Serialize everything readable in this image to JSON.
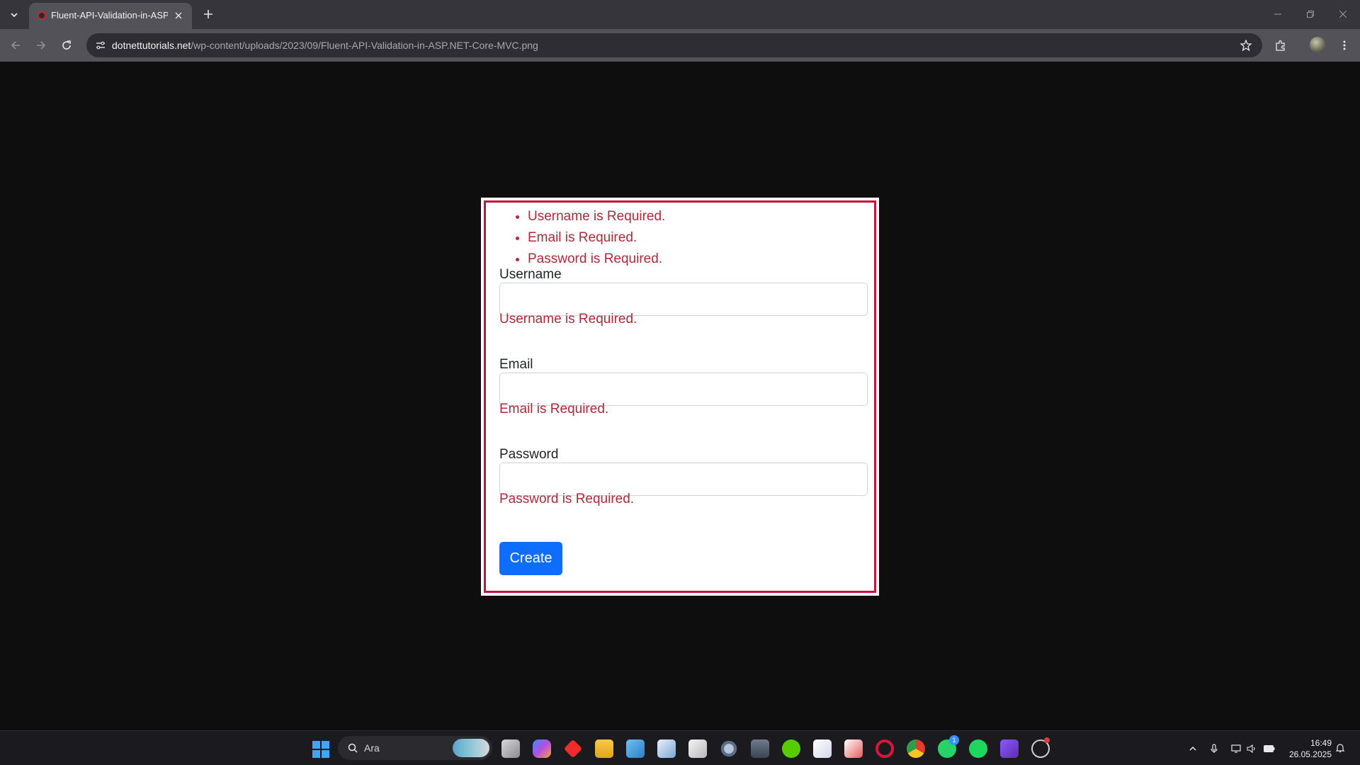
{
  "browser": {
    "tab_title": "Fluent-API-Validation-in-ASP.NET-Core-MVC.png",
    "url_host": "dotnettutorials.net",
    "url_path": "/wp-content/uploads/2023/09/Fluent-API-Validation-in-ASP.NET-Core-MVC.png"
  },
  "form": {
    "summary_errors": [
      "Username is Required.",
      "Email is Required.",
      "Password is Required."
    ],
    "username_label": "Username",
    "username_value": "",
    "username_error": "Username is Required.",
    "email_label": "Email",
    "email_value": "",
    "email_error": "Email is Required.",
    "password_label": "Password",
    "password_value": "",
    "password_error": "Password is Required.",
    "submit_label": "Create"
  },
  "taskbar": {
    "search_placeholder": "Ara",
    "time": "16:49",
    "date": "26.05.2025",
    "whatsapp_badge": "1",
    "apps": [
      "task-view",
      "copilot",
      "anydesk",
      "file-explorer",
      "remote-desktop",
      "monitor",
      "microsoft-store",
      "settings",
      "terminal",
      "duolingo",
      "solitaire",
      "snipping-tool",
      "opera",
      "chrome",
      "whatsapp",
      "spotify",
      "visual-studio",
      "github-desktop"
    ]
  },
  "colors": {
    "accent_blue": "#0d6efd",
    "error_red": "#b02a37",
    "frame_red": "#c2173a"
  }
}
